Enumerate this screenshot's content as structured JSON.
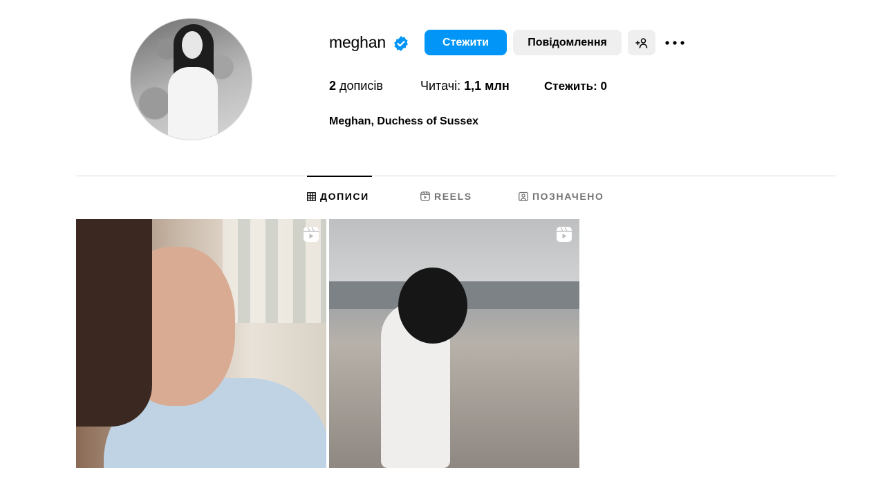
{
  "profile": {
    "username": "meghan",
    "verified": true,
    "follow_label": "Стежити",
    "message_label": "Повідомлення",
    "posts_count": "2",
    "posts_label": "дописів",
    "followers_label": "Читачі:",
    "followers_count": "1,1 млн",
    "following_label": "Стежить:",
    "following_count": "0",
    "display_name": "Meghan, Duchess of Sussex"
  },
  "tabs": [
    {
      "label": "ДОПИСИ",
      "icon": "grid-icon",
      "active": true
    },
    {
      "label": "REELS",
      "icon": "reels-icon",
      "active": false
    },
    {
      "label": "ПОЗНАЧЕНО",
      "icon": "tagged-icon",
      "active": false
    }
  ],
  "posts": [
    {
      "type": "reel",
      "icon": "reel-icon"
    },
    {
      "type": "reel",
      "icon": "reel-icon"
    }
  ],
  "colors": {
    "accent": "#0095f6",
    "secondary_button": "#efefef",
    "divider": "#dbdbdb",
    "muted_text": "#737373"
  }
}
